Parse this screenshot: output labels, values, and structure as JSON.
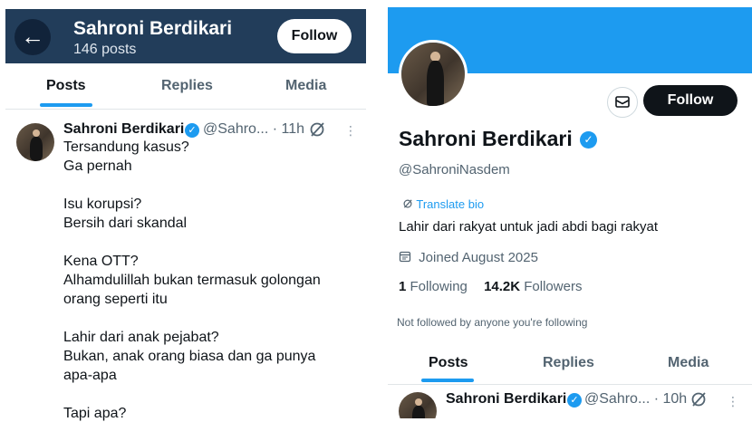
{
  "left_panel": {
    "header": {
      "name": "Sahroni Berdikari",
      "posts_count": "146 posts",
      "follow_label": "Follow"
    },
    "tabs": [
      "Posts",
      "Replies",
      "Media"
    ],
    "post": {
      "name": "Sahroni Berdikari",
      "handle_time": "@Sahro... · 11h",
      "lines": [
        "Tersandung kasus?",
        "Ga pernah",
        "",
        "Isu korupsi?",
        "Bersih dari skandal",
        "",
        "Kena OTT?",
        "Alhamdulillah bukan termasuk golongan",
        "orang seperti itu",
        "",
        "Lahir dari anak pejabat?",
        "Bukan, anak orang biasa dan ga punya",
        "apa-apa",
        "",
        "Tapi apa?"
      ]
    }
  },
  "right_panel": {
    "follow_label": "Follow",
    "name": "Sahroni Berdikari",
    "handle": "@SahroniNasdem",
    "translate_bio": "Translate bio",
    "bio": "Lahir dari rakyat untuk jadi abdi bagi rakyat",
    "joined": "Joined August 2025",
    "following_count": "1",
    "following_label": "Following",
    "followers_count": "14.2K",
    "followers_label": "Followers",
    "not_followed": "Not followed by anyone you're following",
    "tabs": [
      "Posts",
      "Replies",
      "Media"
    ],
    "post": {
      "name": "Sahroni Berdikari",
      "handle_time": "@Sahro... · 10h"
    }
  },
  "colors": {
    "accent": "#1d9bf0",
    "header_bg": "#223d5a",
    "text_primary": "#0f1419",
    "text_secondary": "#536471"
  },
  "icons": [
    "back-arrow-icon",
    "verified-badge-icon",
    "grok-icon",
    "more-icon",
    "mail-icon",
    "translate-icon",
    "calendar-icon"
  ]
}
